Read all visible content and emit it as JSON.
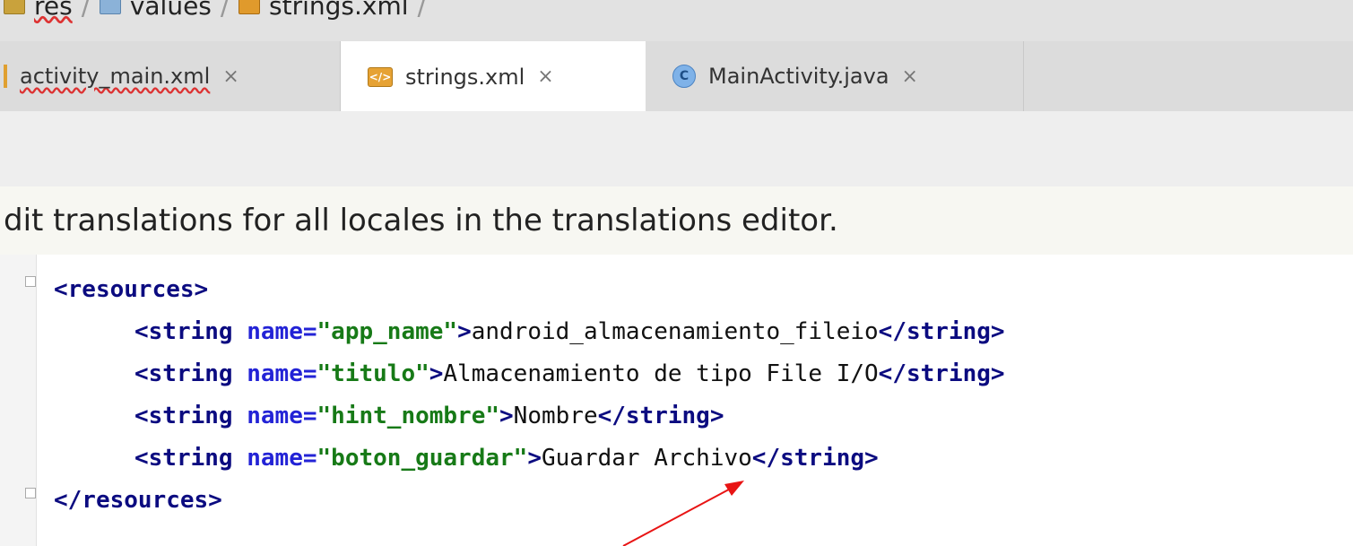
{
  "breadcrumb": {
    "items": [
      {
        "icon": "folder-icon",
        "label": "res"
      },
      {
        "icon": "folder-values-icon",
        "label": "values"
      },
      {
        "icon": "xml-icon",
        "label": "strings.xml"
      }
    ],
    "separator": "/"
  },
  "tabs": [
    {
      "label": "activity_main.xml",
      "close": "×",
      "active": false
    },
    {
      "label": "strings.xml",
      "close": "×",
      "active": true
    },
    {
      "label": "MainActivity.java",
      "close": "×",
      "active": false
    }
  ],
  "notice": {
    "text": "dit translations for all locales in the translations editor."
  },
  "editor": {
    "open_tag": "<resources>",
    "close_tag": "</resources>",
    "lines": [
      {
        "name": "app_name",
        "value": "android_almacenamiento_fileio"
      },
      {
        "name": "titulo",
        "value": "Almacenamiento de tipo File I/O"
      },
      {
        "name": "hint_nombre",
        "value": "Nombre"
      },
      {
        "name": "boton_guardar",
        "value": "Guardar Archivo"
      }
    ],
    "string_open": "<string ",
    "string_close": "</string>",
    "attr_name": "name=",
    "gt": ">"
  },
  "annotation": {
    "color": "#e81414"
  }
}
